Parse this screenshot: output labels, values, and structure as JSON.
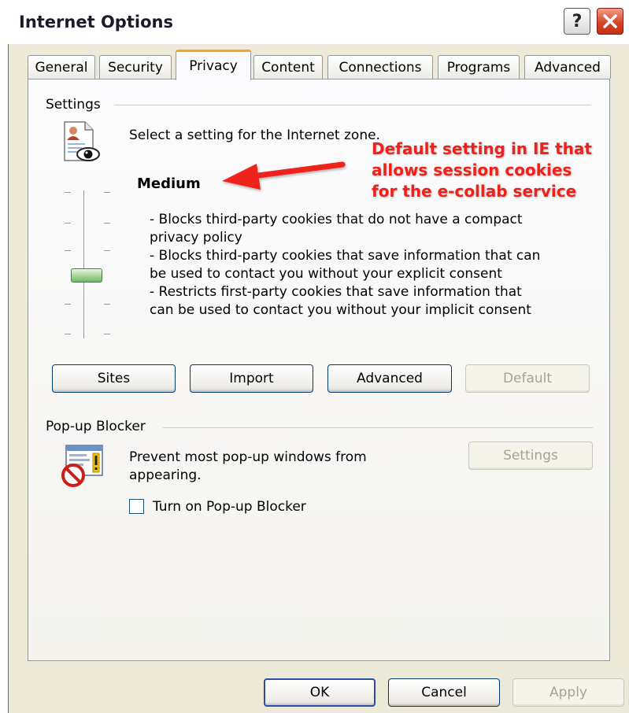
{
  "window": {
    "title": "Internet Options",
    "help_label": "?"
  },
  "tabs": [
    {
      "label": "General"
    },
    {
      "label": "Security"
    },
    {
      "label": "Privacy",
      "active": true
    },
    {
      "label": "Content"
    },
    {
      "label": "Connections"
    },
    {
      "label": "Programs"
    },
    {
      "label": "Advanced"
    }
  ],
  "settings": {
    "group_label": "Settings",
    "zone_text": "Select a setting for the Internet zone.",
    "level": "Medium",
    "description_lines": [
      "- Blocks third-party cookies that do not have a compact",
      "privacy policy",
      "- Blocks third-party cookies that save information that can",
      "be used to contact you without your explicit consent",
      "- Restricts first-party cookies that save information that",
      "can be used to contact you without your implicit consent"
    ],
    "slider_level": "Medium",
    "buttons": {
      "sites": "Sites",
      "import": "Import",
      "advanced": "Advanced",
      "default": "Default"
    }
  },
  "popup_blocker": {
    "group_label": "Pop-up Blocker",
    "text_line1": "Prevent most pop-up windows from",
    "text_line2": "appearing.",
    "settings_button": "Settings",
    "checkbox_label": "Turn on Pop-up Blocker",
    "checkbox_checked": false
  },
  "annotation": {
    "line1": "Default setting in IE that",
    "line2": "allows session cookies",
    "line3": "for the e-collab service",
    "color": "#f0201a"
  },
  "footer": {
    "ok": "OK",
    "cancel": "Cancel",
    "apply": "Apply"
  },
  "icons": {
    "privacy": "privacy-document-eye-icon",
    "popup": "popup-blocker-icon",
    "help": "help-icon",
    "close": "close-icon",
    "arrow": "red-arrow"
  }
}
